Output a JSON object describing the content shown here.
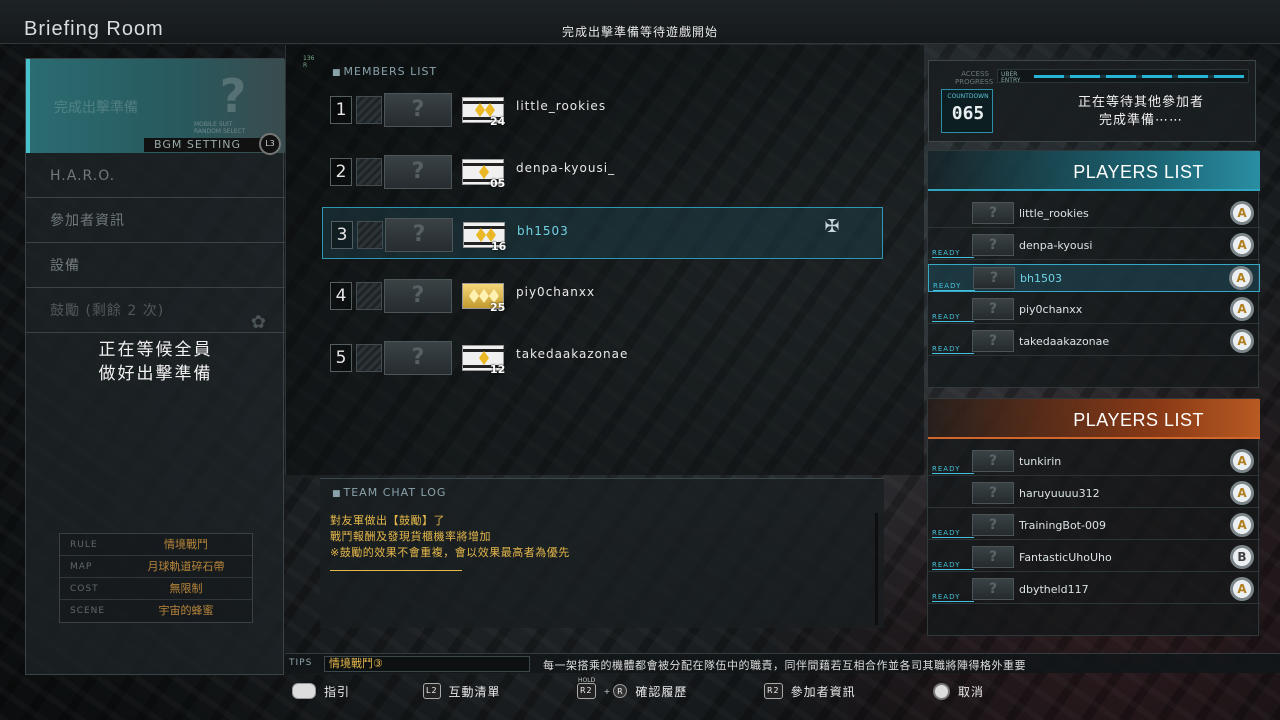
{
  "app_title": "Briefing Room",
  "top_status": "完成出擊準備等待遊戲開始",
  "left_menu": {
    "top_item": {
      "ghost_label": "完成出擊準備",
      "placeholder_glyph": "?",
      "mobile_suit_label": "MOBILE SUIT\nRANDOM SELECT",
      "bgm_label": "BGM SETTING",
      "l3_label": "L3"
    },
    "items": [
      {
        "label": "H.A.R.O."
      },
      {
        "label": "參加者資訊"
      },
      {
        "label": "設備"
      },
      {
        "label": "鼓勵 (剩餘 2 次)"
      }
    ],
    "waiting_message_line1": "正在等候全員",
    "waiting_message_line2": "做好出擊準備",
    "rules": [
      {
        "key": "RULE",
        "value": "情境戰鬥"
      },
      {
        "key": "MAP",
        "value": "月球軌道碎石帶"
      },
      {
        "key": "COST",
        "value": "無限制"
      },
      {
        "key": "SCENE",
        "value": "宇宙的蜂蜜"
      }
    ]
  },
  "members": {
    "header": "MEMBERS LIST",
    "corner_label": "136\nR",
    "rows": [
      {
        "num": "1",
        "name": "little_rookies",
        "level": "24",
        "rank_style": "white"
      },
      {
        "num": "2",
        "name": "denpa-kyousi_",
        "level": "05",
        "rank_style": "white"
      },
      {
        "num": "3",
        "name": "bh1503",
        "level": "16",
        "rank_style": "white"
      },
      {
        "num": "4",
        "name": "piy0chanxx",
        "level": "25",
        "rank_style": "gold"
      },
      {
        "num": "5",
        "name": "takedaakazonae",
        "level": "12",
        "rank_style": "white"
      }
    ],
    "placeholder_glyph": "?",
    "badge_glyph": "✠"
  },
  "chat": {
    "header": "TEAM CHAT LOG",
    "lines": [
      "對友軍做出【鼓勵】了",
      "戰鬥報酬及發現貨櫃機率將增加",
      "※鼓勵的效果不會重複，會以效果最高者為優先"
    ]
  },
  "tips": {
    "label": "TIPS",
    "title": "情境戰鬥③",
    "text": "每一架搭乘的機體都會被分配在隊伍中的職責，同伴間藉若互相合作並各司其職將陣得格外重要"
  },
  "status": {
    "access_label": "ACCESS\nPROGRESS",
    "strip_label": "UBER\nENTRY",
    "countdown_label": "COUNTDOWN",
    "countdown": "065",
    "message_line1": "正在等待其他參加者",
    "message_line2": "完成準備⋯⋯"
  },
  "team_a": {
    "title": "PLAYERS LIST",
    "color": "#2fa5c0",
    "players": [
      {
        "name": "little_rookies",
        "ready": "",
        "rank": "A"
      },
      {
        "name": "denpa-kyousi",
        "ready": "READY",
        "rank": "A"
      },
      {
        "name": "bh1503",
        "ready": "READY",
        "rank": "A"
      },
      {
        "name": "piy0chanxx",
        "ready": "READY",
        "rank": "A"
      },
      {
        "name": "takedaakazonae",
        "ready": "READY",
        "rank": "A"
      }
    ]
  },
  "team_b": {
    "title": "PLAYERS LIST",
    "color": "#d0662b",
    "players": [
      {
        "name": "tunkirin",
        "ready": "READY",
        "rank": "A"
      },
      {
        "name": "haruyuuuu312",
        "ready": "",
        "rank": "A"
      },
      {
        "name": "TrainingBot-009",
        "ready": "READY",
        "rank": "A"
      },
      {
        "name": "FantasticUhoUho",
        "ready": "READY",
        "rank": "B"
      },
      {
        "name": "dbytheld117",
        "ready": "READY",
        "rank": "A"
      }
    ]
  },
  "legend": {
    "guide": {
      "icon": "touchpad",
      "label": "指引"
    },
    "interaction": {
      "icon": "L2",
      "label": "互動清單"
    },
    "history": {
      "icon": "R2",
      "icon2": "R",
      "over": "HOLD",
      "label": "確認履歷"
    },
    "info": {
      "icon": "R2",
      "label": "參加者資訊"
    },
    "cancel": {
      "icon": "circle",
      "label": "取消"
    }
  }
}
